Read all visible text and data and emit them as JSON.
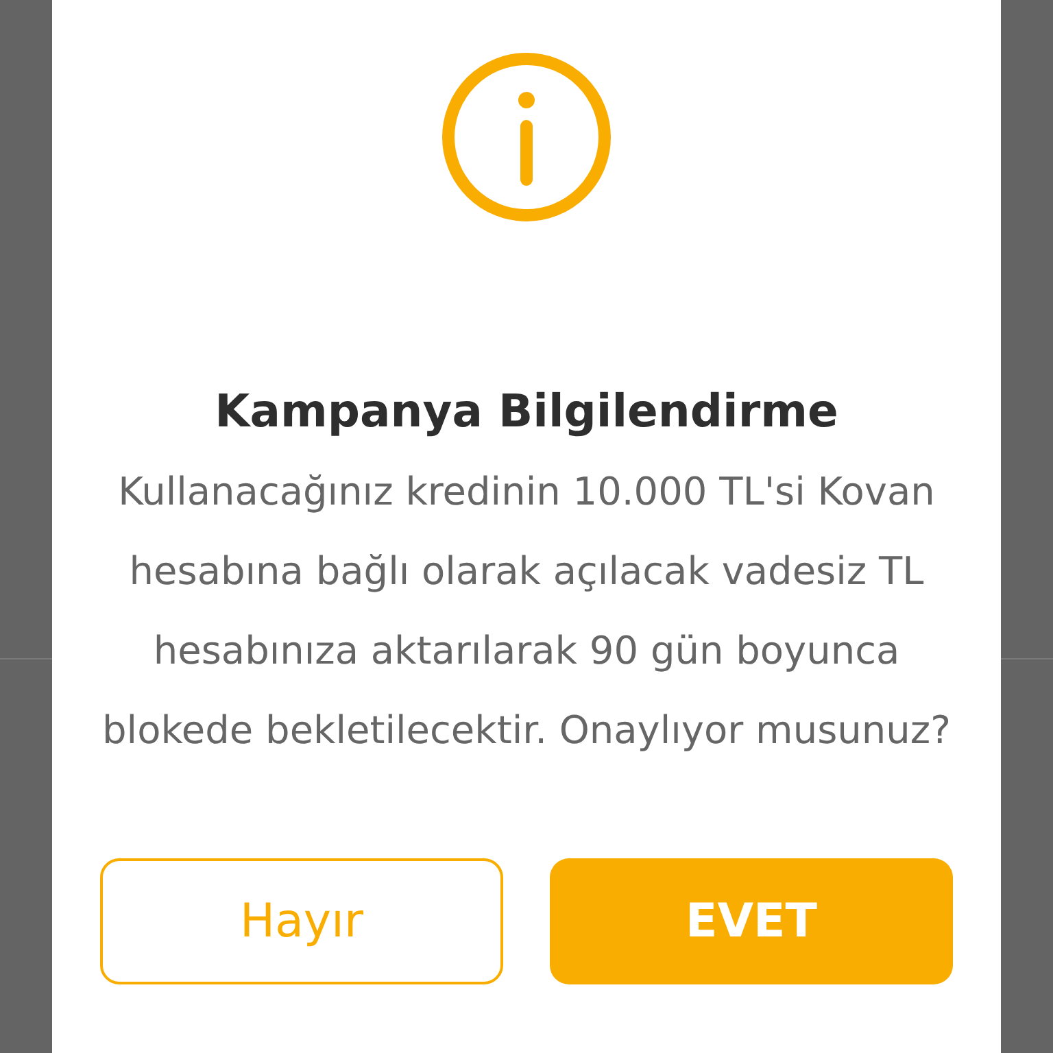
{
  "dialog": {
    "title": "Kampanya Bilgilendirme",
    "message": "Kullanacağınız kredinin 10.000 TL'si Kovan hesabına bağlı olarak açılacak vadesiz TL hesabınıza aktarılarak 90 gün boyunca blokede bekletilecektir. Onaylıyor musunuz?",
    "buttons": [
      {
        "label": "Hayır",
        "kind": "outline"
      },
      {
        "label": "EVET",
        "kind": "filled"
      }
    ]
  }
}
